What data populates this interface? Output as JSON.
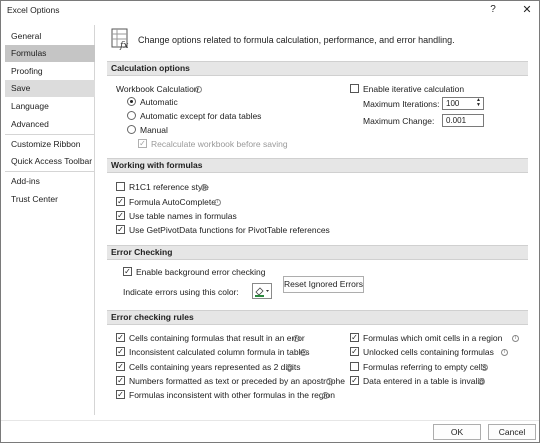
{
  "window": {
    "title": "Excel Options",
    "help": "?",
    "close": "✕"
  },
  "sidebar": {
    "items": [
      {
        "label": "General"
      },
      {
        "label": "Formulas"
      },
      {
        "label": "Proofing"
      },
      {
        "label": "Save"
      },
      {
        "label": "Language"
      },
      {
        "label": "Advanced"
      },
      {
        "label": "Customize Ribbon"
      },
      {
        "label": "Quick Access Toolbar"
      },
      {
        "label": "Add-ins"
      },
      {
        "label": "Trust Center"
      }
    ],
    "selected": "Formulas"
  },
  "header": {
    "text": "Change options related to formula calculation, performance, and error handling."
  },
  "calc": {
    "section": "Calculation options",
    "workbook_label": "Workbook Calculation",
    "automatic": "Automatic",
    "auto_except": "Automatic except for data tables",
    "manual": "Manual",
    "recalc": "Recalculate workbook before saving",
    "selected_mode": "Automatic",
    "iterative": "Enable iterative calculation",
    "max_iter_label": "Maximum Iterations:",
    "max_iter_value": "100",
    "max_change_label": "Maximum Change:",
    "max_change_value": "0.001"
  },
  "working": {
    "section": "Working with formulas",
    "r1c1": "R1C1 reference style",
    "autocomplete": "Formula AutoComplete",
    "tablenames": "Use table names in formulas",
    "getpivot": "Use GetPivotData functions for PivotTable references"
  },
  "errcheck": {
    "section": "Error Checking",
    "enable_bg": "Enable background error checking",
    "indicate": "Indicate errors using this color:",
    "reset": "Reset Ignored Errors"
  },
  "rules": {
    "section": "Error checking rules",
    "left": [
      "Cells containing formulas that result in an error",
      "Inconsistent calculated column formula in tables",
      "Cells containing years represented as 2 digits",
      "Numbers formatted as text or preceded by an apostrophe",
      "Formulas inconsistent with other formulas in the region"
    ],
    "right": [
      "Formulas which omit cells in a region",
      "Unlocked cells containing formulas",
      "Formulas referring to empty cells",
      "Data entered in a table is invalid"
    ]
  },
  "footer": {
    "ok": "OK",
    "cancel": "Cancel"
  },
  "colors": {
    "accent": "#1e7145",
    "error_indicator": "#2a8a3e",
    "selected_nav": "#c5c5c5"
  }
}
